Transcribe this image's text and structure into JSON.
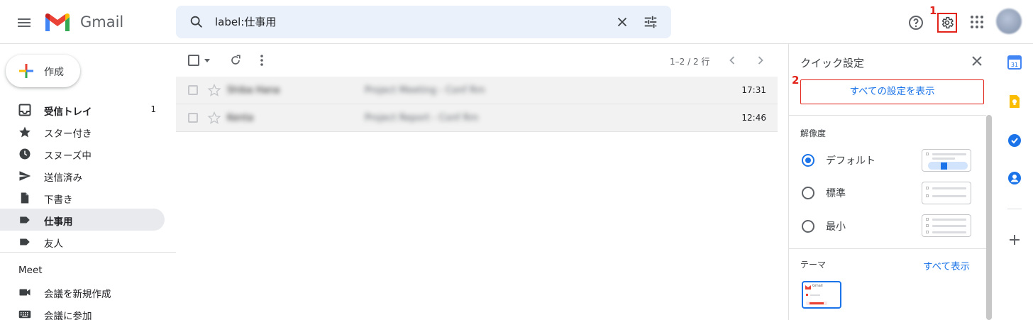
{
  "header": {
    "app_name": "Gmail",
    "search_value": "label:仕事用",
    "avatar": "account-avatar"
  },
  "annotations": {
    "marker_1": "1",
    "marker_2": "2"
  },
  "sidebar": {
    "compose_label": "作成",
    "items": [
      {
        "label": "受信トレイ",
        "count": "1",
        "icon": "inbox-icon"
      },
      {
        "label": "スター付き",
        "icon": "star-icon"
      },
      {
        "label": "スヌーズ中",
        "icon": "clock-icon"
      },
      {
        "label": "送信済み",
        "icon": "send-icon"
      },
      {
        "label": "下書き",
        "icon": "draft-icon"
      },
      {
        "label": "仕事用",
        "icon": "label-icon"
      },
      {
        "label": "友人",
        "icon": "label-icon"
      }
    ],
    "meet": {
      "title": "Meet",
      "items": [
        {
          "label": "会議を新規作成",
          "icon": "videocam-icon"
        },
        {
          "label": "会議に参加",
          "icon": "keyboard-icon"
        }
      ]
    }
  },
  "toolbar": {
    "pager": "1–2 / 2 行"
  },
  "emails": [
    {
      "sender": "Shiba Hana",
      "subject": "Project Meeting - Conf Rm",
      "time": "17:31"
    },
    {
      "sender": "Kenta",
      "subject": "Project Report - Conf Rm",
      "time": "12:46"
    }
  ],
  "quick_settings": {
    "title": "クイック設定",
    "all_settings_button": "すべての設定を表示",
    "density_title": "解像度",
    "density_options": [
      {
        "label": "デフォルト",
        "selected": true
      },
      {
        "label": "標準",
        "selected": false
      },
      {
        "label": "最小",
        "selected": false
      }
    ],
    "theme_title": "テーマ",
    "theme_view_all": "すべて表示",
    "theme_thumb_label": "Gmail"
  },
  "colors": {
    "accent": "#1a73e8",
    "annotation": "#e2231a",
    "active_nav": "#e8eaed"
  }
}
